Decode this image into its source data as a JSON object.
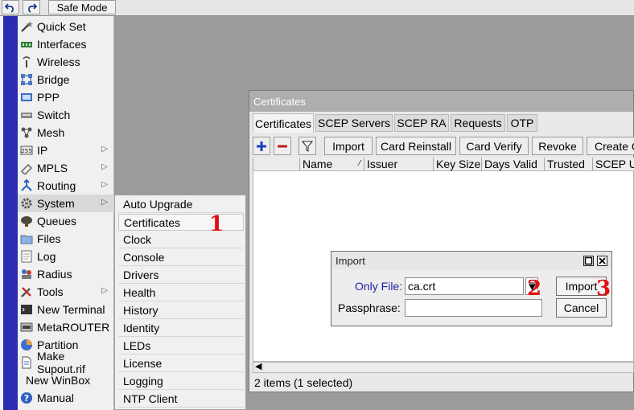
{
  "toolbar": {
    "undo_icon": "undo-icon",
    "redo_icon": "redo-icon",
    "safe_mode_label": "Safe Mode"
  },
  "sidebar": {
    "items": [
      {
        "label": "Quick Set",
        "icon": "wand-icon"
      },
      {
        "label": "Interfaces",
        "icon": "interfaces-icon"
      },
      {
        "label": "Wireless",
        "icon": "wireless-icon"
      },
      {
        "label": "Bridge",
        "icon": "bridge-icon"
      },
      {
        "label": "PPP",
        "icon": "ppp-icon"
      },
      {
        "label": "Switch",
        "icon": "switch-icon"
      },
      {
        "label": "Mesh",
        "icon": "mesh-icon"
      },
      {
        "label": "IP",
        "icon": "ip-icon"
      },
      {
        "label": "MPLS",
        "icon": "mpls-icon"
      },
      {
        "label": "Routing",
        "icon": "routing-icon"
      },
      {
        "label": "System",
        "icon": "gear-icon"
      },
      {
        "label": "Queues",
        "icon": "queues-icon"
      },
      {
        "label": "Files",
        "icon": "folder-icon"
      },
      {
        "label": "Log",
        "icon": "log-icon"
      },
      {
        "label": "Radius",
        "icon": "radius-icon"
      },
      {
        "label": "Tools",
        "icon": "tools-icon"
      },
      {
        "label": "New Terminal",
        "icon": "terminal-icon"
      },
      {
        "label": "MetaROUTER",
        "icon": "metarouter-icon"
      },
      {
        "label": "Partition",
        "icon": "partition-icon"
      },
      {
        "label": "Make Supout.rif",
        "icon": "document-icon"
      },
      {
        "label": "New WinBox",
        "icon": ""
      },
      {
        "label": "Manual",
        "icon": "help-icon"
      }
    ]
  },
  "submenu": {
    "items": [
      "Auto Upgrade",
      "Certificates",
      "Clock",
      "Console",
      "Drivers",
      "Health",
      "History",
      "Identity",
      "LEDs",
      "License",
      "Logging",
      "NTP Client"
    ]
  },
  "annotations": [
    "1",
    "2",
    "3"
  ],
  "certificates_window": {
    "title": "Certificates",
    "tabs": [
      "Certificates",
      "SCEP Servers",
      "SCEP RA",
      "Requests",
      "OTP"
    ],
    "buttons": [
      "Import",
      "Card Reinstall",
      "Card Verify",
      "Revoke",
      "Create C"
    ],
    "columns": [
      "Name",
      "Issuer",
      "Key Size",
      "Days Valid",
      "Trusted",
      "SCEP U"
    ],
    "status": "2 items (1 selected)"
  },
  "import_dialog": {
    "title": "Import",
    "only_file_label": "Only File:",
    "only_file_value": "ca.crt",
    "passphrase_label": "Passphrase:",
    "passphrase_value": "",
    "import_button": "Import",
    "cancel_button": "Cancel"
  }
}
